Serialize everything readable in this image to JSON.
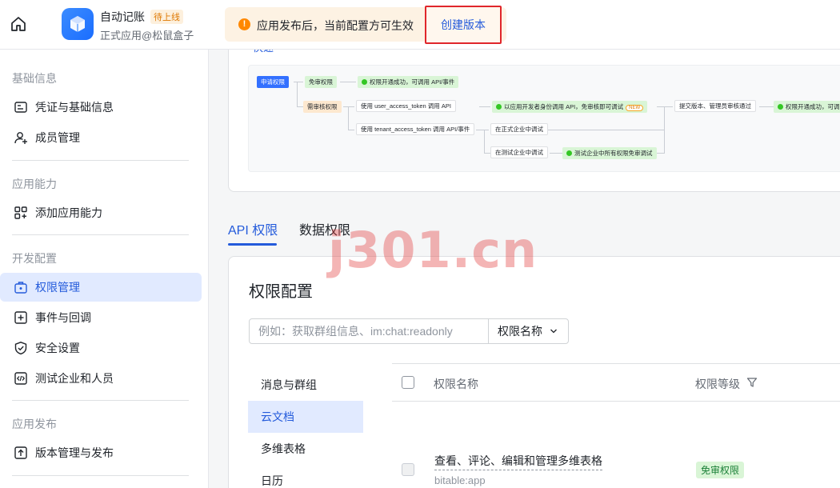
{
  "header": {
    "app_name": "自动记账",
    "app_badge": "待上线",
    "app_subtitle": "正式应用@松鼠盒子",
    "notice_text": "应用发布后，当前配置方可生效",
    "create_version_label": "创建版本"
  },
  "sidebar": {
    "sections": [
      {
        "title": "基础信息",
        "items": [
          {
            "label": "凭证与基础信息",
            "icon": "id-card-icon"
          },
          {
            "label": "成员管理",
            "icon": "add-user-icon"
          }
        ]
      },
      {
        "title": "应用能力",
        "items": [
          {
            "label": "添加应用能力",
            "icon": "add-grid-icon"
          }
        ]
      },
      {
        "title": "开发配置",
        "items": [
          {
            "label": "权限管理",
            "icon": "briefcase-icon",
            "active": true
          },
          {
            "label": "事件与回调",
            "icon": "event-add-icon"
          },
          {
            "label": "安全设置",
            "icon": "shield-check-icon"
          },
          {
            "label": "测试企业和人员",
            "icon": "code-box-icon"
          }
        ]
      },
      {
        "title": "应用发布",
        "items": [
          {
            "label": "版本管理与发布",
            "icon": "upload-box-icon"
          }
        ]
      }
    ]
  },
  "flow": {
    "link_text": "快速",
    "nodes": {
      "apply": "申请权限",
      "free_review": "免审权限",
      "free_result": "权限开通成功，可调用 API/事件",
      "need_review": "需审核权限",
      "user_token": "使用 user_access_token 调用 API",
      "user_token_result": "以应用开发者身份调用 API，免审核即可调试",
      "new_tag": "NEW",
      "tenant_token": "使用 tenant_access_token 调用 API/事件",
      "formal_debug": "在正式企业中调试",
      "test_debug": "在测试企业中调试",
      "test_result": "测试企业中所有权限免审调试",
      "submit": "提交版本、管理员审核通过",
      "final_result": "权限开通成功，可调"
    }
  },
  "tabs": [
    {
      "label": "API 权限",
      "active": true
    },
    {
      "label": "数据权限",
      "active": false
    }
  ],
  "permissions": {
    "title": "权限配置",
    "search_placeholder": "例如：获取群组信息、im:chat:readonly",
    "search_filter": "权限名称",
    "categories": [
      {
        "label": "消息与群组"
      },
      {
        "label": "云文档",
        "active": true
      },
      {
        "label": "多维表格"
      },
      {
        "label": "日历"
      }
    ],
    "columns": {
      "name": "权限名称",
      "level": "权限等级"
    },
    "rows": [
      {
        "name": "查看、评论、编辑和管理多维表格",
        "scope": "bitable:app",
        "level": "免审权限"
      }
    ]
  },
  "watermark": "j301.cn",
  "colors": {
    "accent": "#245bdb",
    "highlight_border": "#e0262b",
    "notice_bg": "#fdf2e3"
  }
}
